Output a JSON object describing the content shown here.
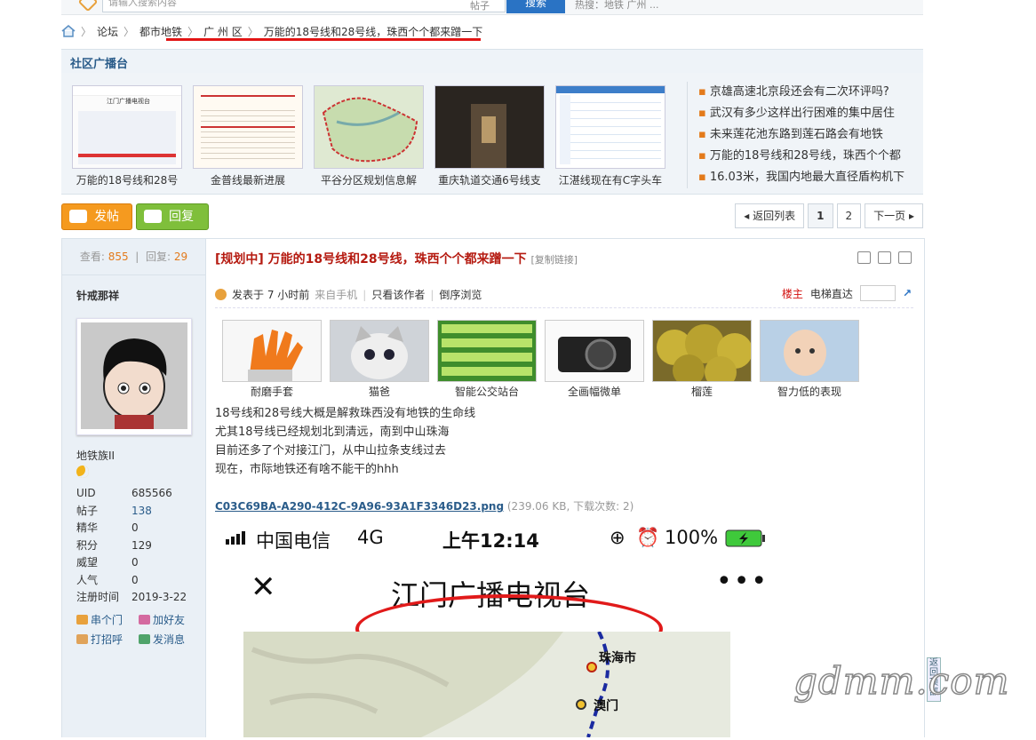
{
  "search": {
    "placeholder": "请输入搜索内容",
    "type_label": "帖子",
    "button": "搜索",
    "hot_label": "热搜：地铁 广州 ..."
  },
  "breadcrumb": [
    "论坛",
    "都市地铁",
    "广 州 区",
    "万能的18号线和28号线，珠西个个都来蹭一下"
  ],
  "broadcast": {
    "title": "社区广播台",
    "thumbs": [
      {
        "caption": "万能的18号线和28号",
        "shot_text": "江门广播电视台"
      },
      {
        "caption": "金普线最新进展"
      },
      {
        "caption": "平谷分区规划信息解"
      },
      {
        "caption": "重庆轨道交通6号线支"
      },
      {
        "caption": "江湛线现在有C字头车"
      }
    ],
    "news": [
      "京雄高速北京段还会有二次环评吗?",
      "武汉有多少这样出行困难的集中居住",
      "未来莲花池东路到莲石路会有地铁",
      "万能的18号线和28号线，珠西个个都",
      "16.03米，我国内地最大直径盾构机下"
    ]
  },
  "actions": {
    "post": "发帖",
    "reply": "回复"
  },
  "pager": {
    "back": "返回列表",
    "pages": [
      "1",
      "2"
    ],
    "next": "下一页"
  },
  "side": {
    "views_label": "查看:",
    "views": "855",
    "replies_label": "回复:",
    "replies": "29",
    "username": "针戒那祥",
    "rank": "地铁族II",
    "info": [
      {
        "k": "UID",
        "v": "685566"
      },
      {
        "k": "帖子",
        "v": "138"
      },
      {
        "k": "精华",
        "v": "0"
      },
      {
        "k": "积分",
        "v": "129"
      },
      {
        "k": "威望",
        "v": "0"
      },
      {
        "k": "人气",
        "v": "0"
      },
      {
        "k": "注册时间",
        "v": "2019-3-22"
      }
    ],
    "links": [
      "串个门",
      "加好友",
      "打招呼",
      "发消息"
    ]
  },
  "post": {
    "title": "[规划中] 万能的18号线和28号线，珠西个个都来蹭一下",
    "copy_link": "[复制链接]",
    "meta_posted": "发表于 7 小时前",
    "meta_from": "来自手机",
    "only_author": "只看该作者",
    "reverse": "倒序浏览",
    "floor_label": "楼主",
    "elevator": "电梯直达",
    "ads": [
      "耐磨手套",
      "猫爸",
      "智能公交站台",
      "全画幅微单",
      "榴莲",
      "智力低的表现"
    ],
    "body": [
      "18号线和28号线大概是解救珠西没有地铁的生命线",
      "尤其18号线已经规划北到清远，南到中山珠海",
      "目前还多了个对接江门，从中山拉条支线过去",
      "现在，市际地铁还有啥不能干的hhh"
    ],
    "attachment_name": "C03C69BA-A290-412C-9A96-93A1F3346D23.png",
    "attachment_meta": "(239.06 KB, 下载次数: 2)",
    "phone": {
      "carrier": "中国电信",
      "network": "4G",
      "time": "上午12:14",
      "battery": "100%",
      "app_title": "江门广播电视台",
      "map_label1": "珠海市",
      "map_label2": "澳门"
    }
  },
  "watermark": "gdmm.com",
  "sidetool": "返回顶部"
}
